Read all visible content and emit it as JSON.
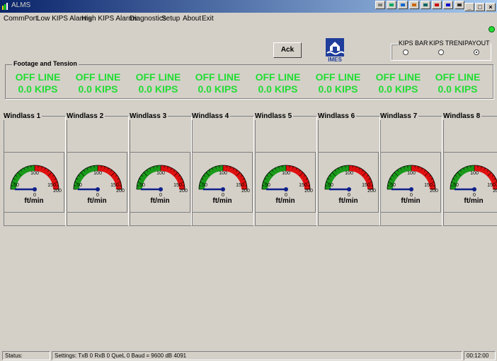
{
  "window": {
    "title": "ALMS"
  },
  "menu": [
    "CommPort",
    "Low KIPS Alarms",
    "High KIPS Alarms",
    "Diagnostics",
    "Setup",
    "About",
    "Exit"
  ],
  "toolbar": {
    "ack_label": "Ack",
    "logo_text": "IMES"
  },
  "display_mode": {
    "options": [
      "KIPS BAR",
      "KIPS TREND",
      "PAYOUT"
    ],
    "selected": "PAYOUT"
  },
  "footage_group": {
    "label": "Footage and Tension",
    "entries": [
      {
        "status": "OFF LINE",
        "kips": "0.0 KIPS"
      },
      {
        "status": "OFF LINE",
        "kips": "0.0 KIPS"
      },
      {
        "status": "OFF LINE",
        "kips": "0.0 KIPS"
      },
      {
        "status": "OFF LINE",
        "kips": "0.0 KIPS"
      },
      {
        "status": "OFF LINE",
        "kips": "0.0 KIPS"
      },
      {
        "status": "OFF LINE",
        "kips": "0.0 KIPS"
      },
      {
        "status": "OFF LINE",
        "kips": "0.0 KIPS"
      },
      {
        "status": "OFF LINE",
        "kips": "0.0 KIPS"
      }
    ]
  },
  "windlasses": [
    {
      "name": "Windlass 1",
      "unit": "ft/min",
      "value": 0
    },
    {
      "name": "Windlass 2",
      "unit": "ft/min",
      "value": 0
    },
    {
      "name": "Windlass 3",
      "unit": "ft/min",
      "value": 0
    },
    {
      "name": "Windlass 4",
      "unit": "ft/min",
      "value": 0
    },
    {
      "name": "Windlass 5",
      "unit": "ft/min",
      "value": 0
    },
    {
      "name": "Windlass 6",
      "unit": "ft/min",
      "value": 0
    },
    {
      "name": "Windlass 7",
      "unit": "ft/min",
      "value": 0
    },
    {
      "name": "Windlass 8",
      "unit": "ft/min",
      "value": 0
    }
  ],
  "gauge": {
    "ticks": [
      "0",
      "50",
      "100",
      "150",
      "200"
    ],
    "min": 0,
    "max": 200,
    "green_end": 100
  },
  "status_bar": {
    "status_label": "Status:",
    "settings": "Settings: TxB  0 RxB  0 QueL  0 Baud = 9600  dB  4091",
    "time": "00:12:00"
  },
  "colors": {
    "online_text": "#22dd33",
    "gauge_green": "#1a9a1a",
    "gauge_red": "#e01010",
    "needle": "#10208a",
    "indicator": "#22dd33"
  }
}
